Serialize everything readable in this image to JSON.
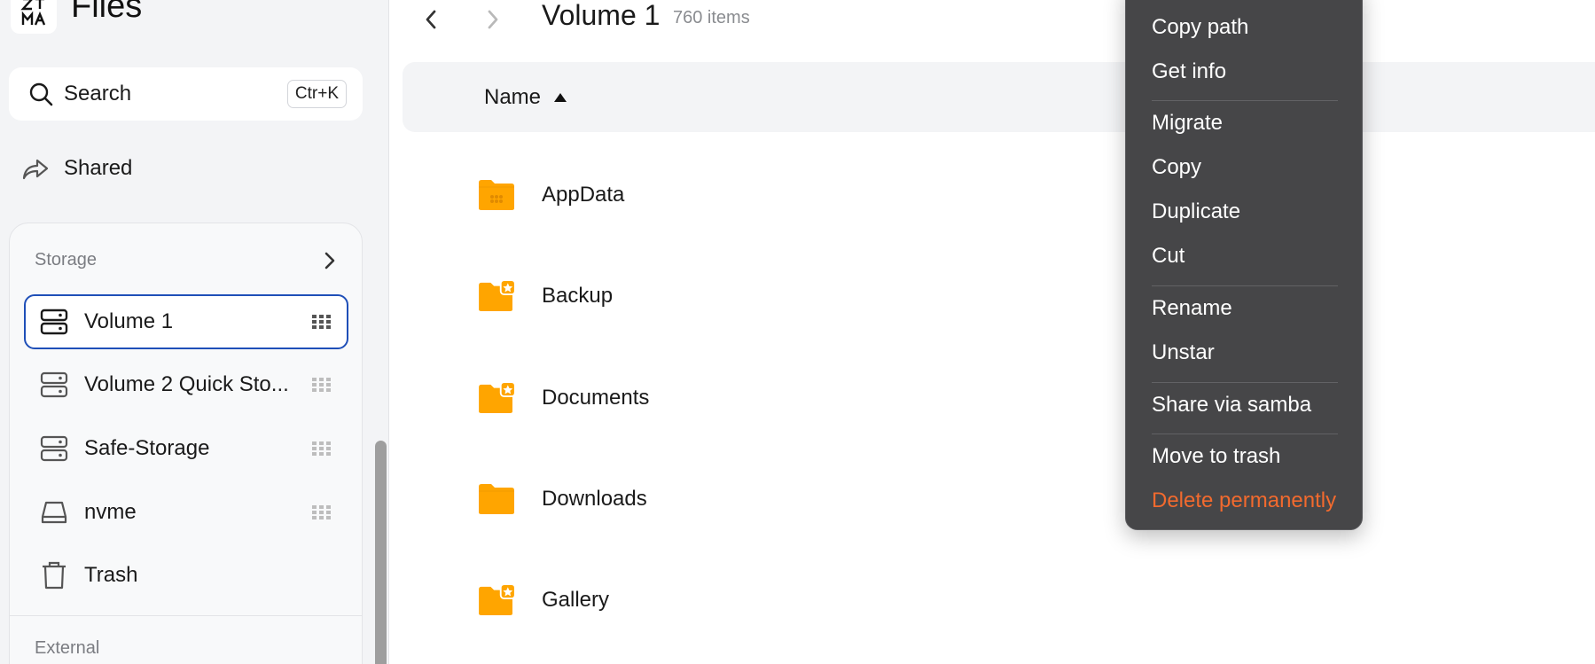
{
  "app": {
    "title": "Files",
    "logo_text": "ZIMA"
  },
  "sidebar": {
    "search": {
      "label": "Search",
      "shortcut": "Ctr+K"
    },
    "shared": {
      "label": "Shared"
    },
    "storage": {
      "header": "Storage",
      "items": [
        {
          "label": "Volume 1",
          "active": true
        },
        {
          "label": "Volume 2 Quick Sto..."
        },
        {
          "label": "Safe-Storage"
        },
        {
          "label": "nvme"
        },
        {
          "label": "Trash"
        }
      ]
    },
    "external": {
      "header": "External"
    }
  },
  "main": {
    "folder_title": "Volume 1",
    "item_count": "760 items",
    "columns": {
      "name": "Name"
    },
    "files": [
      {
        "name": "AppData",
        "starred": false,
        "type": "app-folder"
      },
      {
        "name": "Backup",
        "starred": true
      },
      {
        "name": "Documents",
        "starred": true
      },
      {
        "name": "Downloads",
        "starred": false
      },
      {
        "name": "Gallery",
        "starred": true
      }
    ]
  },
  "context_menu": {
    "items": [
      "Copy path",
      "Get info",
      "Migrate",
      "Copy",
      "Duplicate",
      "Cut",
      "Rename",
      "Unstar",
      "Share via samba",
      "Move to trash",
      "Delete permanently"
    ]
  },
  "colors": {
    "folder": "#ffa500",
    "star_badge": "#ffffff",
    "active_border": "#1f4fb8",
    "menu_bg": "#464648",
    "danger": "#f26a2e"
  }
}
